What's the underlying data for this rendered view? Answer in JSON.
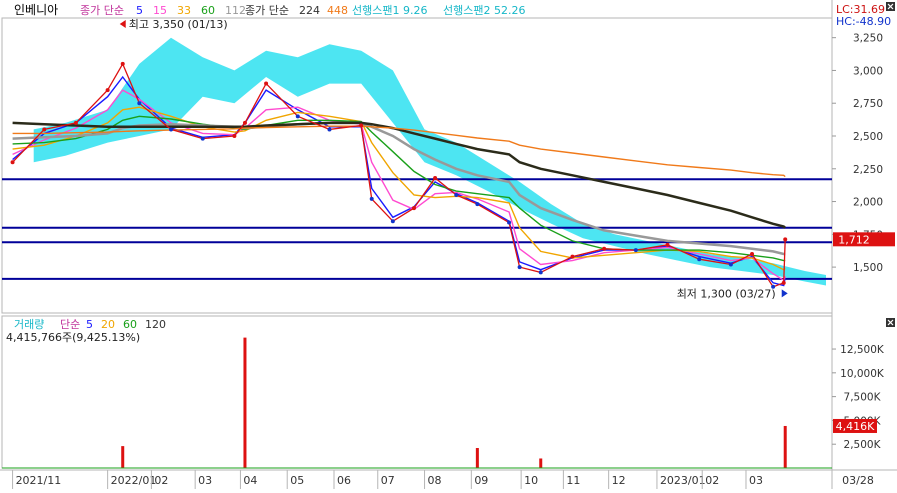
{
  "colors": {
    "background": "#ffffff",
    "frame": "#b5b5b5",
    "hline": "#000099",
    "cloud": "#2ee0f0",
    "candle_up": "#dd1111",
    "candle_down": "#1133cc",
    "ma5": "#1a1aff",
    "ma15": "#ff4ad0",
    "ma33": "#f0a500",
    "ma60": "#1aa01a",
    "ma112": "#999999",
    "ma224": "#2b2b1a",
    "ma448": "#f07a1a",
    "price_badge": "#dd1111",
    "volume_up": "#dd1111",
    "volume_down": "#1133cc"
  },
  "header": {
    "stock_name": "인베니아",
    "ma_label": "종가 단순",
    "ma_periods_a": [
      "5",
      "15",
      "33",
      "60",
      "112"
    ],
    "ma_periods_b": [
      "224",
      "448"
    ],
    "span1_text": "선행스팬1 9.26",
    "span2_text": "선행스팬2 52.26",
    "lc_text": "LC:31.69",
    "hc_text": "HC:-48.90",
    "close_icon": "x-icon"
  },
  "annotations": {
    "high_text": "최고 3,350 (01/13)",
    "low_text": "최저 1,300 (03/27)"
  },
  "volume_header": {
    "title": "거래량",
    "ma_label": "단순",
    "periods": [
      "5",
      "20",
      "60",
      "120"
    ],
    "current_text": "4,415,766주(9,425.13%)",
    "close_icon": "x-icon"
  },
  "price_badge": "1,712",
  "volume_badge": "4,416K",
  "x_axis": {
    "labels": [
      "2021/11",
      "2022/01",
      "02",
      "03",
      "04",
      "05",
      "06",
      "07",
      "08",
      "09",
      "10",
      "11",
      "12",
      "2023/01",
      "02",
      "03"
    ],
    "right_label": "03/28"
  },
  "chart_data": [
    {
      "type": "candlestick",
      "title": "인베니아",
      "y_ticks": [
        "3,250",
        "3,000",
        "2,750",
        "2,500",
        "2,250",
        "2,000",
        "1,750",
        "1,500"
      ],
      "y_tick_values": [
        3250,
        3000,
        2750,
        2500,
        2250,
        2000,
        1750,
        1500
      ],
      "ylim": [
        1150,
        3400
      ],
      "horizontal_lines": [
        2170,
        1800,
        1690,
        1410
      ],
      "price_series": {
        "dates": [
          "2021-11-01",
          "2021-11-22",
          "2021-12-13",
          "2022-01-03",
          "2022-01-13",
          "2022-01-24",
          "2022-02-14",
          "2022-03-07",
          "2022-03-28",
          "2022-04-04",
          "2022-04-18",
          "2022-05-09",
          "2022-05-30",
          "2022-06-20",
          "2022-06-27",
          "2022-07-11",
          "2022-07-25",
          "2022-08-08",
          "2022-08-22",
          "2022-09-05",
          "2022-09-26",
          "2022-10-03",
          "2022-10-17",
          "2022-11-07",
          "2022-11-28",
          "2022-12-19",
          "2023-01-09",
          "2023-01-30",
          "2023-02-20",
          "2023-03-06",
          "2023-03-20",
          "2023-03-27",
          "2023-03-28"
        ],
        "close": [
          2300,
          2550,
          2600,
          2850,
          3050,
          2750,
          2550,
          2480,
          2500,
          2600,
          2900,
          2650,
          2550,
          2580,
          2020,
          1850,
          1950,
          2180,
          2050,
          1980,
          1840,
          1500,
          1460,
          1580,
          1640,
          1630,
          1670,
          1560,
          1520,
          1600,
          1350,
          1380,
          1712
        ]
      },
      "moving_averages": [
        {
          "period": "5",
          "color": "ma5",
          "values": [
            2320,
            2520,
            2600,
            2800,
            2950,
            2780,
            2560,
            2490,
            2510,
            2600,
            2850,
            2700,
            2570,
            2570,
            2100,
            1880,
            1960,
            2150,
            2060,
            1990,
            1850,
            1540,
            1480,
            1570,
            1630,
            1630,
            1660,
            1580,
            1530,
            1580,
            1380,
            1360,
            1420
          ]
        },
        {
          "period": "15",
          "color": "ma15",
          "values": [
            2360,
            2470,
            2560,
            2700,
            2850,
            2780,
            2600,
            2520,
            2510,
            2560,
            2700,
            2720,
            2620,
            2590,
            2300,
            2010,
            1940,
            2060,
            2070,
            2020,
            1920,
            1640,
            1520,
            1550,
            1610,
            1630,
            1650,
            1600,
            1550,
            1570,
            1450,
            1400,
            1430
          ]
        },
        {
          "period": "33",
          "color": "ma33",
          "values": [
            2400,
            2430,
            2500,
            2600,
            2700,
            2720,
            2650,
            2570,
            2530,
            2540,
            2620,
            2680,
            2650,
            2610,
            2450,
            2220,
            2050,
            2030,
            2040,
            2030,
            1990,
            1800,
            1620,
            1570,
            1590,
            1610,
            1630,
            1620,
            1580,
            1570,
            1520,
            1480,
            1490
          ]
        },
        {
          "period": "60",
          "color": "ma60",
          "values": [
            2440,
            2450,
            2480,
            2550,
            2620,
            2650,
            2630,
            2590,
            2560,
            2550,
            2580,
            2620,
            2620,
            2610,
            2530,
            2380,
            2230,
            2130,
            2080,
            2060,
            2030,
            1950,
            1820,
            1700,
            1640,
            1630,
            1630,
            1630,
            1610,
            1590,
            1570,
            1550,
            1550
          ]
        },
        {
          "period": "112",
          "color": "ma112",
          "values": [
            2480,
            2490,
            2500,
            2520,
            2560,
            2580,
            2590,
            2580,
            2570,
            2560,
            2570,
            2590,
            2600,
            2600,
            2570,
            2500,
            2400,
            2320,
            2250,
            2200,
            2150,
            2050,
            1950,
            1860,
            1780,
            1740,
            1700,
            1680,
            1660,
            1640,
            1620,
            1600,
            1600
          ]
        },
        {
          "period": "224",
          "color": "ma224",
          "values": [
            2600,
            2590,
            2580,
            2570,
            2570,
            2570,
            2570,
            2570,
            2570,
            2570,
            2580,
            2590,
            2600,
            2600,
            2590,
            2560,
            2520,
            2480,
            2440,
            2400,
            2360,
            2300,
            2250,
            2200,
            2150,
            2100,
            2050,
            1990,
            1930,
            1880,
            1830,
            1810,
            1800
          ]
        },
        {
          "period": "448",
          "color": "ma448",
          "values": [
            2520,
            2520,
            2525,
            2530,
            2535,
            2540,
            2545,
            2550,
            2555,
            2560,
            2565,
            2570,
            2575,
            2575,
            2570,
            2560,
            2545,
            2525,
            2505,
            2485,
            2460,
            2430,
            2400,
            2370,
            2340,
            2310,
            2280,
            2260,
            2240,
            2220,
            2205,
            2200,
            2190
          ]
        }
      ],
      "ichimoku_cloud": {
        "span1": "9.26",
        "span2": "52.26",
        "dates": [
          "2021-11-15",
          "2021-12-06",
          "2022-01-03",
          "2022-01-24",
          "2022-02-14",
          "2022-03-07",
          "2022-03-28",
          "2022-04-18",
          "2022-05-09",
          "2022-05-30",
          "2022-06-20",
          "2022-07-11",
          "2022-08-01",
          "2022-08-22",
          "2022-09-12",
          "2022-10-03",
          "2022-10-24",
          "2022-11-14",
          "2022-12-05",
          "2022-12-26",
          "2023-01-16",
          "2023-02-06",
          "2023-02-27",
          "2023-03-20",
          "2023-04-10",
          "2023-04-24"
        ],
        "top": [
          2550,
          2600,
          2700,
          3050,
          3250,
          3100,
          3000,
          3150,
          3100,
          3200,
          3150,
          3000,
          2550,
          2450,
          2300,
          2150,
          1980,
          1830,
          1750,
          1700,
          1650,
          1600,
          1570,
          1530,
          1470,
          1440
        ],
        "bottom": [
          2300,
          2350,
          2450,
          2500,
          2550,
          2800,
          2750,
          2950,
          2800,
          2900,
          2900,
          2600,
          2300,
          2200,
          2080,
          1950,
          1830,
          1720,
          1660,
          1600,
          1550,
          1500,
          1470,
          1440,
          1390,
          1360
        ]
      },
      "markers": [
        {
          "label": "최고 3,350 (01/13)",
          "date": "2022-01-13",
          "value": 3350
        },
        {
          "label": "최저 1,300 (03/27)",
          "date": "2023-03-27",
          "value": 1300
        }
      ],
      "current_price": 1712
    },
    {
      "type": "bar",
      "title": "거래량",
      "y_ticks": [
        "12,500K",
        "10,000K",
        "7,500K",
        "5,000K",
        "2,500K"
      ],
      "y_tick_values": [
        12500,
        10000,
        7500,
        5000,
        2500
      ],
      "ylim": [
        0,
        14500
      ],
      "unit": "K",
      "volume_spikes": [
        {
          "date": "2022-01-13",
          "value": 2300
        },
        {
          "date": "2022-04-04",
          "value": 13700
        },
        {
          "date": "2022-09-05",
          "value": 2100
        },
        {
          "date": "2022-10-17",
          "value": 1000
        },
        {
          "date": "2023-03-28",
          "value": 4416
        }
      ],
      "moving_average_periods": [
        "5",
        "20",
        "60",
        "120"
      ],
      "current_volume": "4,416K"
    }
  ]
}
